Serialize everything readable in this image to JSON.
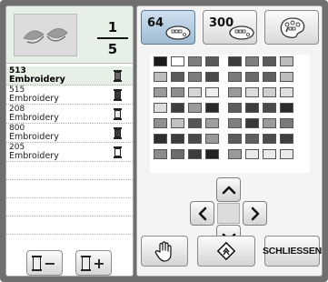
{
  "header": {
    "position_current": "1",
    "position_total": "5"
  },
  "thread_list": [
    {
      "code": "513",
      "label": "Embroidery",
      "selected": true,
      "spool_color": "#6a6a6a"
    },
    {
      "code": "515",
      "label": "Embroidery",
      "selected": false,
      "spool_color": "#3a3a3a"
    },
    {
      "code": "208",
      "label": "Embroidery",
      "selected": false,
      "spool_color": "#e8e8e8"
    },
    {
      "code": "800",
      "label": "Embroidery",
      "selected": false,
      "spool_color": "#3c3c3c"
    },
    {
      "code": "205",
      "label": "Embroidery",
      "selected": false,
      "spool_color": "#ffffff"
    }
  ],
  "left_buttons": {
    "remove_label": "−",
    "add_label": "+"
  },
  "tabs": [
    {
      "label": "64",
      "active": true,
      "icon": "thread-chart-icon"
    },
    {
      "label": "300",
      "active": false,
      "icon": "thread-chart-icon"
    },
    {
      "label": "",
      "active": false,
      "icon": "palette-icon"
    }
  ],
  "palette_rows": [
    [
      "#1a1a1a",
      "#ffffff",
      "#7f7f7f",
      "#5a5a5a",
      "#3c3c3c",
      "#7f7f7f",
      "#5a5a5a",
      "#bcbcbc"
    ],
    [
      "#bdbdbd",
      "#5c5c5c",
      "#7d7d7d",
      "#4a4a4a",
      "#7a7a7a",
      "#6a6a6a",
      "#5f5f5f",
      "#bcbcbc"
    ],
    [
      "#9a9a9a",
      "#8c8c8c",
      "#d5d5d5",
      "#eeeeee",
      "#9a9a9a",
      "#dcdcdc",
      "#cfcfcf",
      "#dedede"
    ],
    [
      "#dedede",
      "#3e3e3e",
      "#9a9a9a",
      "#2a2a2a",
      "#5c5c5c",
      "#3c3c3c",
      "#4a4a4a",
      "#2c2c2c"
    ],
    [
      "#8f8f8f",
      "#c2c2c2",
      "#555555",
      "#9f9f9f",
      "#7e7e7e",
      "#3a3a3a",
      "#9a9a9a",
      "#7a7a7a"
    ],
    [
      "#2e2e2e",
      "#3c3c3c",
      "#4a4a4a",
      "#9a9a9a",
      "#5c5c5c",
      "#5f5f5f",
      "#4b4b4b",
      "#3f3f3f"
    ],
    [
      "#8c8c8c",
      "#6c6c6c",
      "#3c3c3c",
      "#222222",
      "#9a9a9a",
      "#eaeaea",
      "#eaeaea",
      "#eaeaea"
    ]
  ],
  "bottom_buttons": {
    "close_label": "SCHLIESSEN"
  }
}
